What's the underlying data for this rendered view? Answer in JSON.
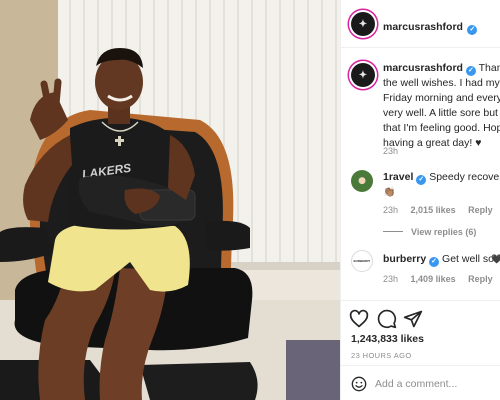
{
  "post": {
    "image_alt": "Photo of a smiling man in a leather lounge chair making a peace sign, arm in a sling, wearing a Lakers vest and yellow shorts",
    "jersey_text": "LAKERS"
  },
  "header": {
    "username": "marcusrashford",
    "verified": true,
    "avatar_icon": "profile-avatar"
  },
  "caption": {
    "username": "marcusrashford",
    "lines": [
      "Thank yo",
      "the well wishes. I had my sur",
      "Friday morning and everythin",
      "very well. A little sore but oth",
      "that I'm feeling good. Hope",
      "having a great day! ♥"
    ],
    "time": "23h"
  },
  "comments": [
    {
      "username": "1ravel",
      "verified": true,
      "text": "Speedy recovery ki",
      "emoji": "👏🏽",
      "time": "23h",
      "likes": "2,015 likes",
      "reply_label": "Reply",
      "view_replies": "View replies (6)"
    },
    {
      "username": "burberry",
      "verified": true,
      "text": "Get well soon",
      "heart": "🖤",
      "time": "23h",
      "likes": "1,409 likes",
      "reply_label": "Reply"
    }
  ],
  "actions": {
    "like_icon": "heart-icon",
    "comment_icon": "comment-icon",
    "share_icon": "share-icon",
    "likes_count": "1,243,833 likes",
    "time_ago": "23 HOURS AGO"
  },
  "add_comment": {
    "emoji_icon": "emoji-icon",
    "placeholder": "Add a comment..."
  },
  "colors": {
    "accent": "#3897f0",
    "text": "#262626",
    "muted": "#8e8e8e",
    "border": "#efefef",
    "story_ring": "#d6249f"
  }
}
